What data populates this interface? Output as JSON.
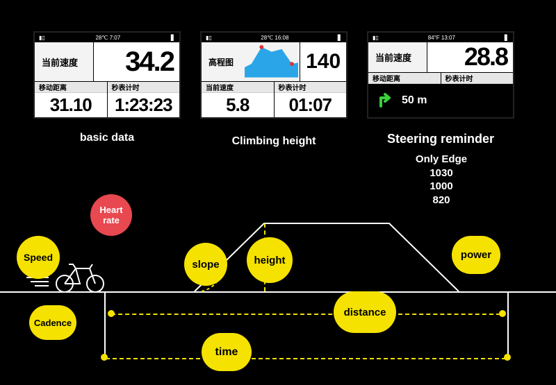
{
  "status": {
    "temp1": "28℃ 7:07",
    "temp2": "28℃ 16:08",
    "temp3": "84°F 13:07"
  },
  "screen1": {
    "caption": "basic data",
    "topLabel": "当前速度",
    "topValue": "34.2",
    "botLeftLabel": "移动距离",
    "botLeftValue": "31.10",
    "botRightLabel": "秒表计时",
    "botRightValue": "1:23:23"
  },
  "screen2": {
    "caption": "Climbing height",
    "chartLabel": "高程图",
    "chartValue": "140",
    "botLeftLabel": "当前速度",
    "botLeftValue": "5.8",
    "botRightLabel": "秒表计时",
    "botRightValue": "01:07"
  },
  "screen3": {
    "caption": "Steering reminder",
    "topLabel": "当前速度",
    "topValue": "28.8",
    "midLeftLabel": "移动距离",
    "midRightLabel": "秒表计时",
    "navDistance": "50 m"
  },
  "extra": {
    "line1": "Only Edge",
    "line2": "1030",
    "line3": "1000",
    "line4": "820"
  },
  "bubbles": {
    "speed": "Speed",
    "heartRate": "Heart\nrate",
    "cadence": "Cadence",
    "slope": "slope",
    "height": "height",
    "time": "time",
    "distance": "distance",
    "power": "power"
  }
}
